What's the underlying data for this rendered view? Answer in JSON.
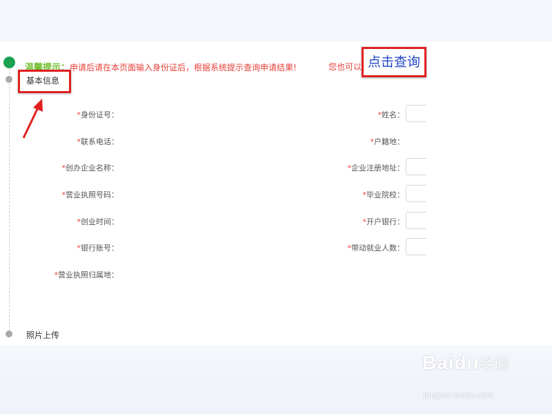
{
  "notice": {
    "label": "温馨提示：",
    "message": "申请后请在本页面输入身份证后，根据系统提示查询申请结果!",
    "extra": "您也可以",
    "query_button": "点击查询"
  },
  "sections": {
    "basic_info": "基本信息",
    "photo_upload": "照片上传"
  },
  "form": {
    "required_mark": "*",
    "left": [
      {
        "label": "身份证号",
        "sep": "：",
        "value": ""
      },
      {
        "label": "联系电话",
        "sep": "：",
        "value": ""
      },
      {
        "label": "创办企业名称",
        "sep": "：",
        "value": ""
      },
      {
        "label": "营业执照号码",
        "sep": "：",
        "value": ""
      },
      {
        "label": "创业时间",
        "sep": "：",
        "value": ""
      },
      {
        "label": "银行账号",
        "sep": "：",
        "value": ""
      },
      {
        "label": "营业执照归属地",
        "sep": "：",
        "value": ""
      }
    ],
    "right": [
      {
        "label": "姓名",
        "sep": "：",
        "value": ""
      },
      {
        "label": "户籍地",
        "sep": "：",
        "value": ""
      },
      {
        "label": "企业注册地址",
        "sep": "：",
        "value": ""
      },
      {
        "label": "毕业院校",
        "sep": "：",
        "value": ""
      },
      {
        "label": "开户银行",
        "sep": "：",
        "value": ""
      },
      {
        "label": "带动就业人数",
        "sep": "：",
        "value": ""
      }
    ]
  },
  "watermark": {
    "logo": "Bai",
    "logo_mid": "du",
    "cn": "经验",
    "url": "jingyan.baidu.com"
  },
  "colors": {
    "accent_red": "#e02020",
    "notice_green": "#6fbf2a",
    "link_blue": "#2348c8",
    "timeline_green": "#1aa251"
  }
}
